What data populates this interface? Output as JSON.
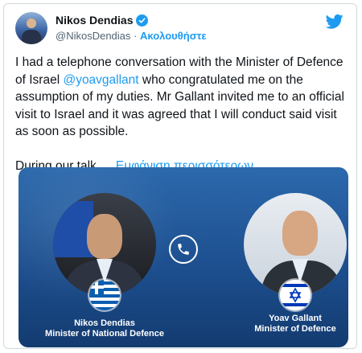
{
  "tweet": {
    "author": {
      "display_name": "Nikos Dendias",
      "handle": "@NikosDendias",
      "separator": "·",
      "follow_label": "Ακολουθήστε",
      "verified": true
    },
    "text_parts": {
      "part1": "I had a telephone conversation with the Minister of Defence of Israel ",
      "mention": "@yoavgallant",
      "part2": " who congratulated me on the assumption of my duties. Mr Gallant invited me to an official visit to Israel and it was agreed that I will conduct said visit as soon as possible.",
      "part3": "During our talk,… ",
      "show_more": "Εμφάνιση περισσότερων"
    }
  },
  "media": {
    "left_person": {
      "name": "Nikos Dendias",
      "title": "Minister of National Defence"
    },
    "right_person": {
      "name": "Yoav Gallant",
      "title": "Minister of Defence"
    }
  },
  "colors": {
    "accent": "#1d9bf0",
    "media_blue": "#1d4f8f",
    "text": "#0f1419",
    "muted": "#536471"
  },
  "icons": {
    "brand": "twitter-bird-icon",
    "verified": "verified-badge-icon",
    "phone": "phone-icon"
  }
}
